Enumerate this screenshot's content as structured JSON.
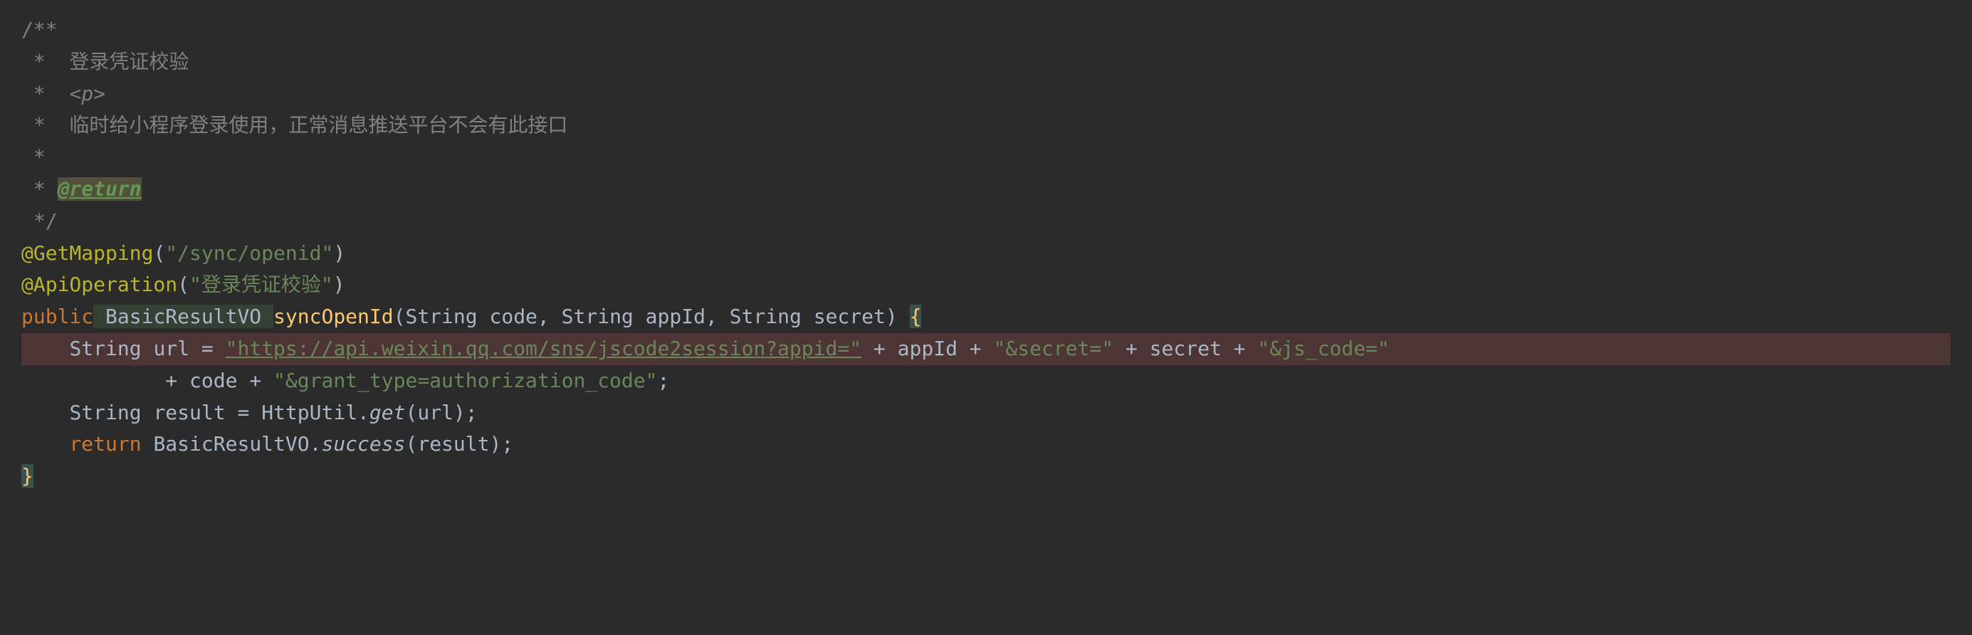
{
  "code": {
    "javadoc": {
      "open": "/**",
      "line1_star": " *",
      "line1_text": "  登录凭证校验",
      "line2_star": " *",
      "line2_tag": "<p>",
      "line3_star": " *",
      "line3_text": "  临时给小程序登录使用，正常消息推送平台不会有此接口",
      "line4_star": " *",
      "line5_star": " * ",
      "line5_tag": "@return",
      "close": " */"
    },
    "annotation1": {
      "name": "@GetMapping",
      "open_paren": "(",
      "value": "\"/sync/openid\"",
      "close_paren": ")"
    },
    "annotation2": {
      "name": "@ApiOperation",
      "open_paren": "(",
      "value": "\"登录凭证校验\"",
      "close_paren": ")"
    },
    "method_sig": {
      "modifier": "public",
      "return_type": " BasicResultVO ",
      "method_name": "syncOpenId",
      "open_paren": "(",
      "param1_type": "String ",
      "param1_name": "code",
      "comma1": ", ",
      "param2_type": "String ",
      "param2_name": "appId",
      "comma2": ", ",
      "param3_type": "String ",
      "param3_name": "secret",
      "close_paren": ") ",
      "open_brace": "{"
    },
    "body_line1": {
      "indent": "    ",
      "type": "String ",
      "var": "url ",
      "eq": "= ",
      "str1": "\"https://api.weixin.qq.com/sns/jscode2session?appid=\"",
      "plus1": " + ",
      "var1": "appId ",
      "plus2": "+ ",
      "str2": "\"&secret=\"",
      "plus3": " + ",
      "var2": "secret ",
      "plus4": "+ ",
      "str3": "\"&js_code=\""
    },
    "body_line2": {
      "indent": "            ",
      "plus1": "+ ",
      "var1": "code ",
      "plus2": "+ ",
      "str1": "\"&grant_type=authorization_code\"",
      "semi": ";"
    },
    "body_line3": {
      "indent": "    ",
      "type": "String ",
      "var": "result ",
      "eq": "= ",
      "class": "HttpUtil",
      "dot": ".",
      "method": "get",
      "open_paren": "(",
      "arg": "url",
      "close_paren": ")",
      "semi": ";"
    },
    "body_line4": {
      "indent": "    ",
      "keyword": "return ",
      "class": "BasicResultVO",
      "dot": ".",
      "method": "success",
      "open_paren": "(",
      "arg": "result",
      "close_paren": ")",
      "semi": ";"
    },
    "close_brace": "}"
  }
}
